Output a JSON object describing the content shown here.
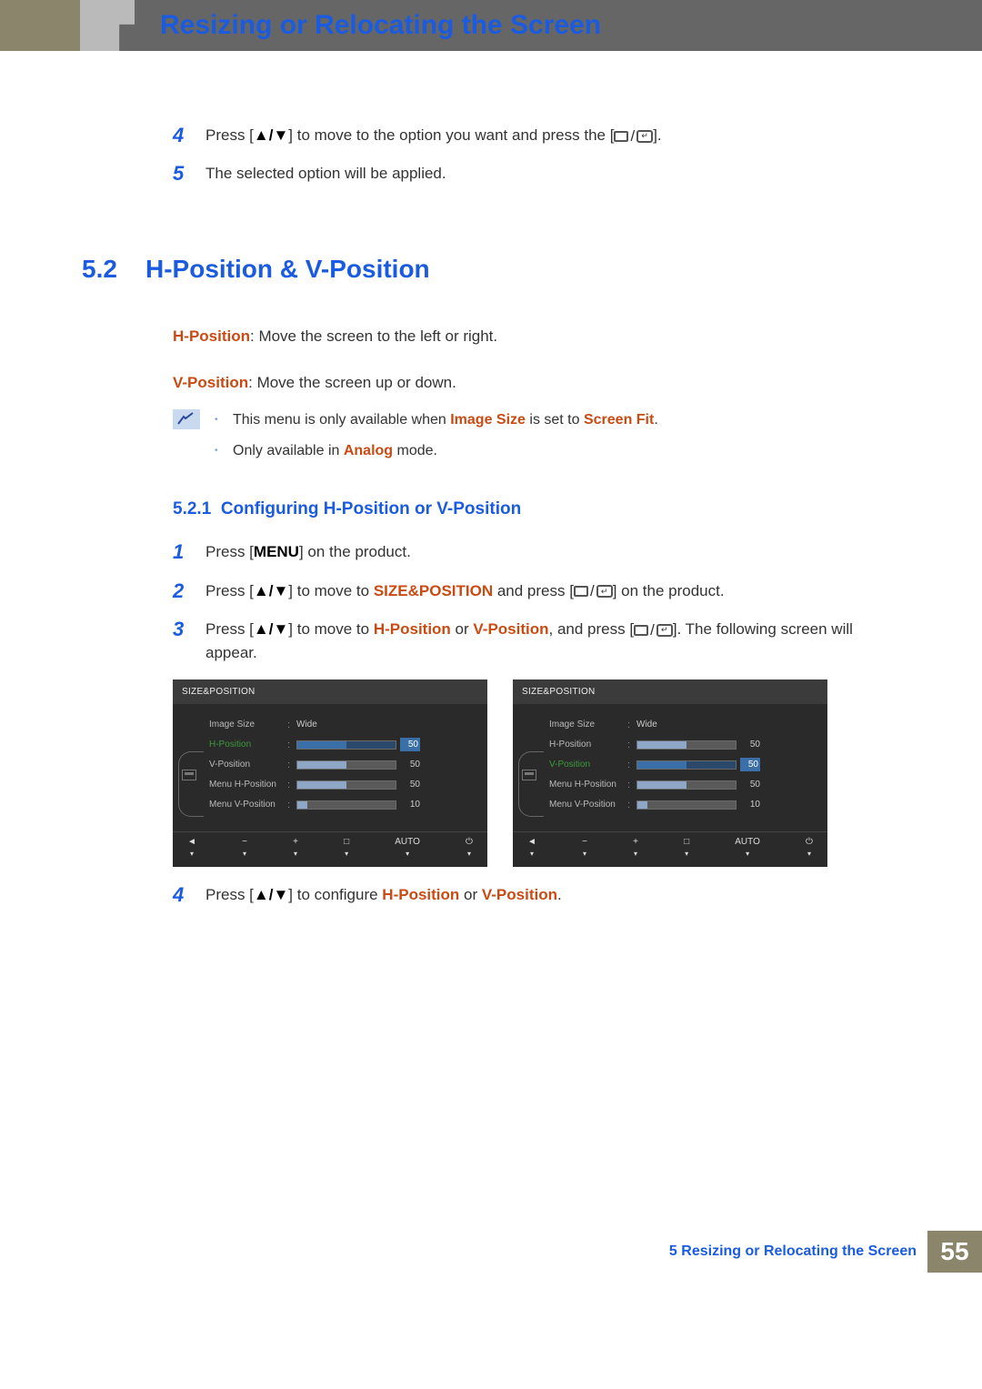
{
  "header": {
    "title": "Resizing or Relocating the Screen"
  },
  "pre_steps": [
    {
      "num": "4",
      "text_parts": [
        "Press [",
        "▲/▼",
        "] to move to the option you want and press the [",
        "ICON_RECT_ENTER",
        "]."
      ]
    },
    {
      "num": "5",
      "text_parts": [
        "The selected option will be applied."
      ]
    }
  ],
  "section": {
    "number": "5.2",
    "title": "H-Position & V-Position",
    "hpos_label": "H-Position",
    "hpos_desc": ": Move the screen to the left or right.",
    "vpos_label": "V-Position",
    "vpos_desc": ": Move the screen up or down.",
    "notes": [
      {
        "pre": "This menu is only available when ",
        "red1": "Image Size",
        "mid": " is set to ",
        "red2": "Screen Fit",
        "post": "."
      },
      {
        "pre": "Only available in ",
        "red1": "Analog",
        "mid": "",
        "red2": "",
        "post": " mode."
      }
    ]
  },
  "subsection": {
    "number": "5.2.1",
    "title": "Configuring H-Position or V-Position",
    "steps": [
      {
        "num": "1",
        "segs": [
          {
            "t": "Press ["
          },
          {
            "t": "MENU",
            "b": true
          },
          {
            "t": "] on the product."
          }
        ]
      },
      {
        "num": "2",
        "segs": [
          {
            "t": "Press ["
          },
          {
            "t": "▲/▼",
            "b": true
          },
          {
            "t": "] to move to "
          },
          {
            "t": "SIZE&POSITION",
            "r": true
          },
          {
            "t": " and press ["
          },
          {
            "t": "ICON_RECT_ENTER",
            "icon": true
          },
          {
            "t": "] on the product."
          }
        ]
      },
      {
        "num": "3",
        "segs": [
          {
            "t": "Press ["
          },
          {
            "t": "▲/▼",
            "b": true
          },
          {
            "t": "] to move to "
          },
          {
            "t": "H-Position",
            "r": true
          },
          {
            "t": " or "
          },
          {
            "t": "V-Position",
            "r": true
          },
          {
            "t": ", and press ["
          },
          {
            "t": "ICON_RECT_ENTER",
            "icon": true
          },
          {
            "t": "]. The following screen will appear."
          }
        ]
      }
    ],
    "step4": {
      "num": "4",
      "segs": [
        {
          "t": "Press ["
        },
        {
          "t": "▲/▼",
          "b": true
        },
        {
          "t": "] to configure "
        },
        {
          "t": "H-Position",
          "r": true
        },
        {
          "t": " or "
        },
        {
          "t": "V-Position",
          "r": true
        },
        {
          "t": "."
        }
      ]
    }
  },
  "osd": {
    "panel_title": "SIZE&POSITION",
    "rows": [
      {
        "label": "Image Size",
        "value_text": "Wide",
        "bar": null
      },
      {
        "label": "H-Position",
        "value_text": null,
        "bar": 50
      },
      {
        "label": "V-Position",
        "value_text": null,
        "bar": 50
      },
      {
        "label": "Menu H-Position",
        "value_text": null,
        "bar": 50
      },
      {
        "label": "Menu V-Position",
        "value_text": null,
        "bar": 10
      }
    ],
    "highlight_left": "H-Position",
    "highlight_right": "V-Position",
    "foot_icons": [
      "◄",
      "−",
      "+",
      "",
      "AUTO",
      "⏻"
    ],
    "foot_caret": "▾"
  },
  "footer": {
    "chapter": "5 Resizing or Relocating the Screen",
    "page": "55"
  }
}
